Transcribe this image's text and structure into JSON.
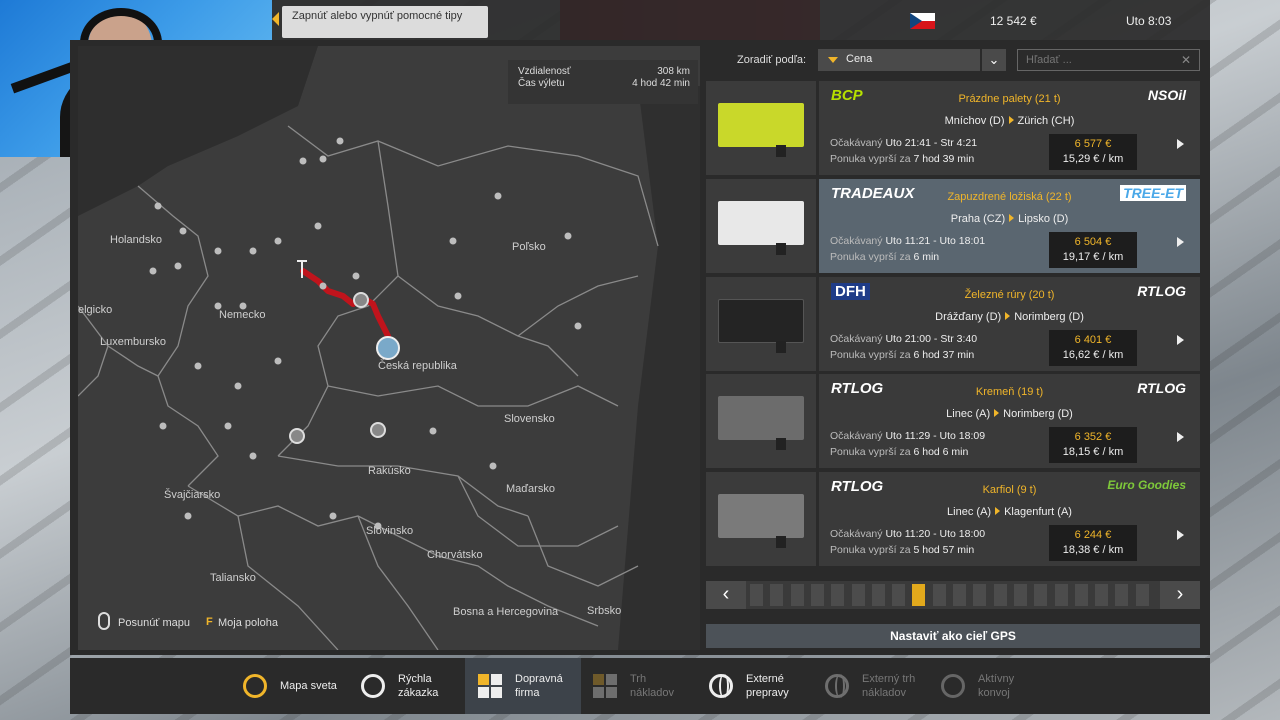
{
  "top": {
    "tip": "Zapnúť alebo vypnúť pomocné tipy",
    "money": "12 542 €",
    "clock": "Uto 8:03",
    "flag": "czech-flag"
  },
  "map": {
    "distance_label": "Vzdialenosť",
    "distance_value": "308 km",
    "time_label": "Čas výletu",
    "time_value": "4 hod 42 min",
    "countries": [
      "Holandsko",
      "Nemecko",
      "Poľsko",
      "elgicko",
      "Luxembursko",
      "Česká republika",
      "Slovensko",
      "Rakúsko",
      "Maďarsko",
      "Švajčiarsko",
      "Slovinsko",
      "Chorvátsko",
      "Taliansko",
      "Bosna a Hercegovina",
      "Srbsko"
    ],
    "hint_move": "Posunúť mapu",
    "hint_key": "F",
    "hint_position": "Moja poloha"
  },
  "jobs_panel": {
    "sort_label": "Zoradiť podľa:",
    "sort_value": "Cena",
    "search_placeholder": "Hľadať ...",
    "jobs": [
      {
        "company_from": "BCP",
        "company_to": "NSOil",
        "cargo": "Prázdne palety  (21 t)",
        "from": "Mníchov (D)",
        "to": "Zürich (CH)",
        "expected_label": "Očakávaný",
        "expected": "Uto 21:41 - Str 4:21",
        "offer_label": "Ponuka vyprší za",
        "offer": "7 hod 39 min",
        "price": "6 577 €",
        "rate": "15,29 € / km",
        "trailer_color": "#c9d82a"
      },
      {
        "company_from": "TRADEAUX",
        "company_to": "TREE-ET",
        "cargo": "Zapuzdrené ložiská (22 t)",
        "from": "Praha (CZ)",
        "to": "Lipsko (D)",
        "expected_label": "Očakávaný",
        "expected": "Uto 11:21 - Uto 18:01",
        "offer_label": "Ponuka vyprší za",
        "offer": "6 min",
        "price": "6 504 €",
        "rate": "19,17 € / km",
        "trailer_color": "#e8e8e8"
      },
      {
        "company_from": "DFH",
        "company_to": "RTLOG",
        "cargo": "Železné rúry (20 t)",
        "from": "Drážďany (D)",
        "to": "Norimberg (D)",
        "expected_label": "Očakávaný",
        "expected": "Uto 21:00 - Str 3:40",
        "offer_label": "Ponuka vyprší za",
        "offer": "6 hod 37 min",
        "price": "6 401 €",
        "rate": "16,62 € / km",
        "trailer_color": "#2a2a2a"
      },
      {
        "company_from": "RTLOG",
        "company_to": "RTLOG",
        "cargo": "Kremeň  (19 t)",
        "from": "Linec (A)",
        "to": "Norimberg (D)",
        "expected_label": "Očakávaný",
        "expected": "Uto 11:29 - Uto 18:09",
        "offer_label": "Ponuka vyprší za",
        "offer": "6 hod 6 min",
        "price": "6 352 €",
        "rate": "18,15 € / km",
        "trailer_color": "#6c6c6c"
      },
      {
        "company_from": "RTLOG",
        "company_to": "Euro Goodies",
        "cargo": "Karfiol (9 t)",
        "from": "Linec (A)",
        "to": "Klagenfurt (A)",
        "expected_label": "Očakávaný",
        "expected": "Uto 11:20 - Uto 18:00",
        "offer_label": "Ponuka vyprší za",
        "offer": "5 hod 57 min",
        "price": "6 244 €",
        "rate": "18,38 € / km",
        "trailer_color": "#7a7a7a"
      }
    ],
    "pager_active_index": 8,
    "pager_total": 20,
    "gps_button": "Nastaviť ako cieľ GPS"
  },
  "bottom_nav": [
    {
      "label1": "Mapa sveta",
      "label2": "",
      "icon": "world-map-icon",
      "state": "normal"
    },
    {
      "label1": "Rýchla",
      "label2": "zákazka",
      "icon": "quick-job-icon",
      "state": "normal"
    },
    {
      "label1": "Dopravná",
      "label2": "firma",
      "icon": "freight-market-icon",
      "state": "active"
    },
    {
      "label1": "Trh",
      "label2": "nákladov",
      "icon": "cargo-market-icon",
      "state": "disabled"
    },
    {
      "label1": "Externé",
      "label2": "prepravy",
      "icon": "external-jobs-icon",
      "state": "normal"
    },
    {
      "label1": "Externý trh",
      "label2": "nákladov",
      "icon": "external-cargo-icon",
      "state": "disabled"
    },
    {
      "label1": "Aktívny",
      "label2": "konvoj",
      "icon": "active-convoy-icon",
      "state": "disabled"
    }
  ]
}
